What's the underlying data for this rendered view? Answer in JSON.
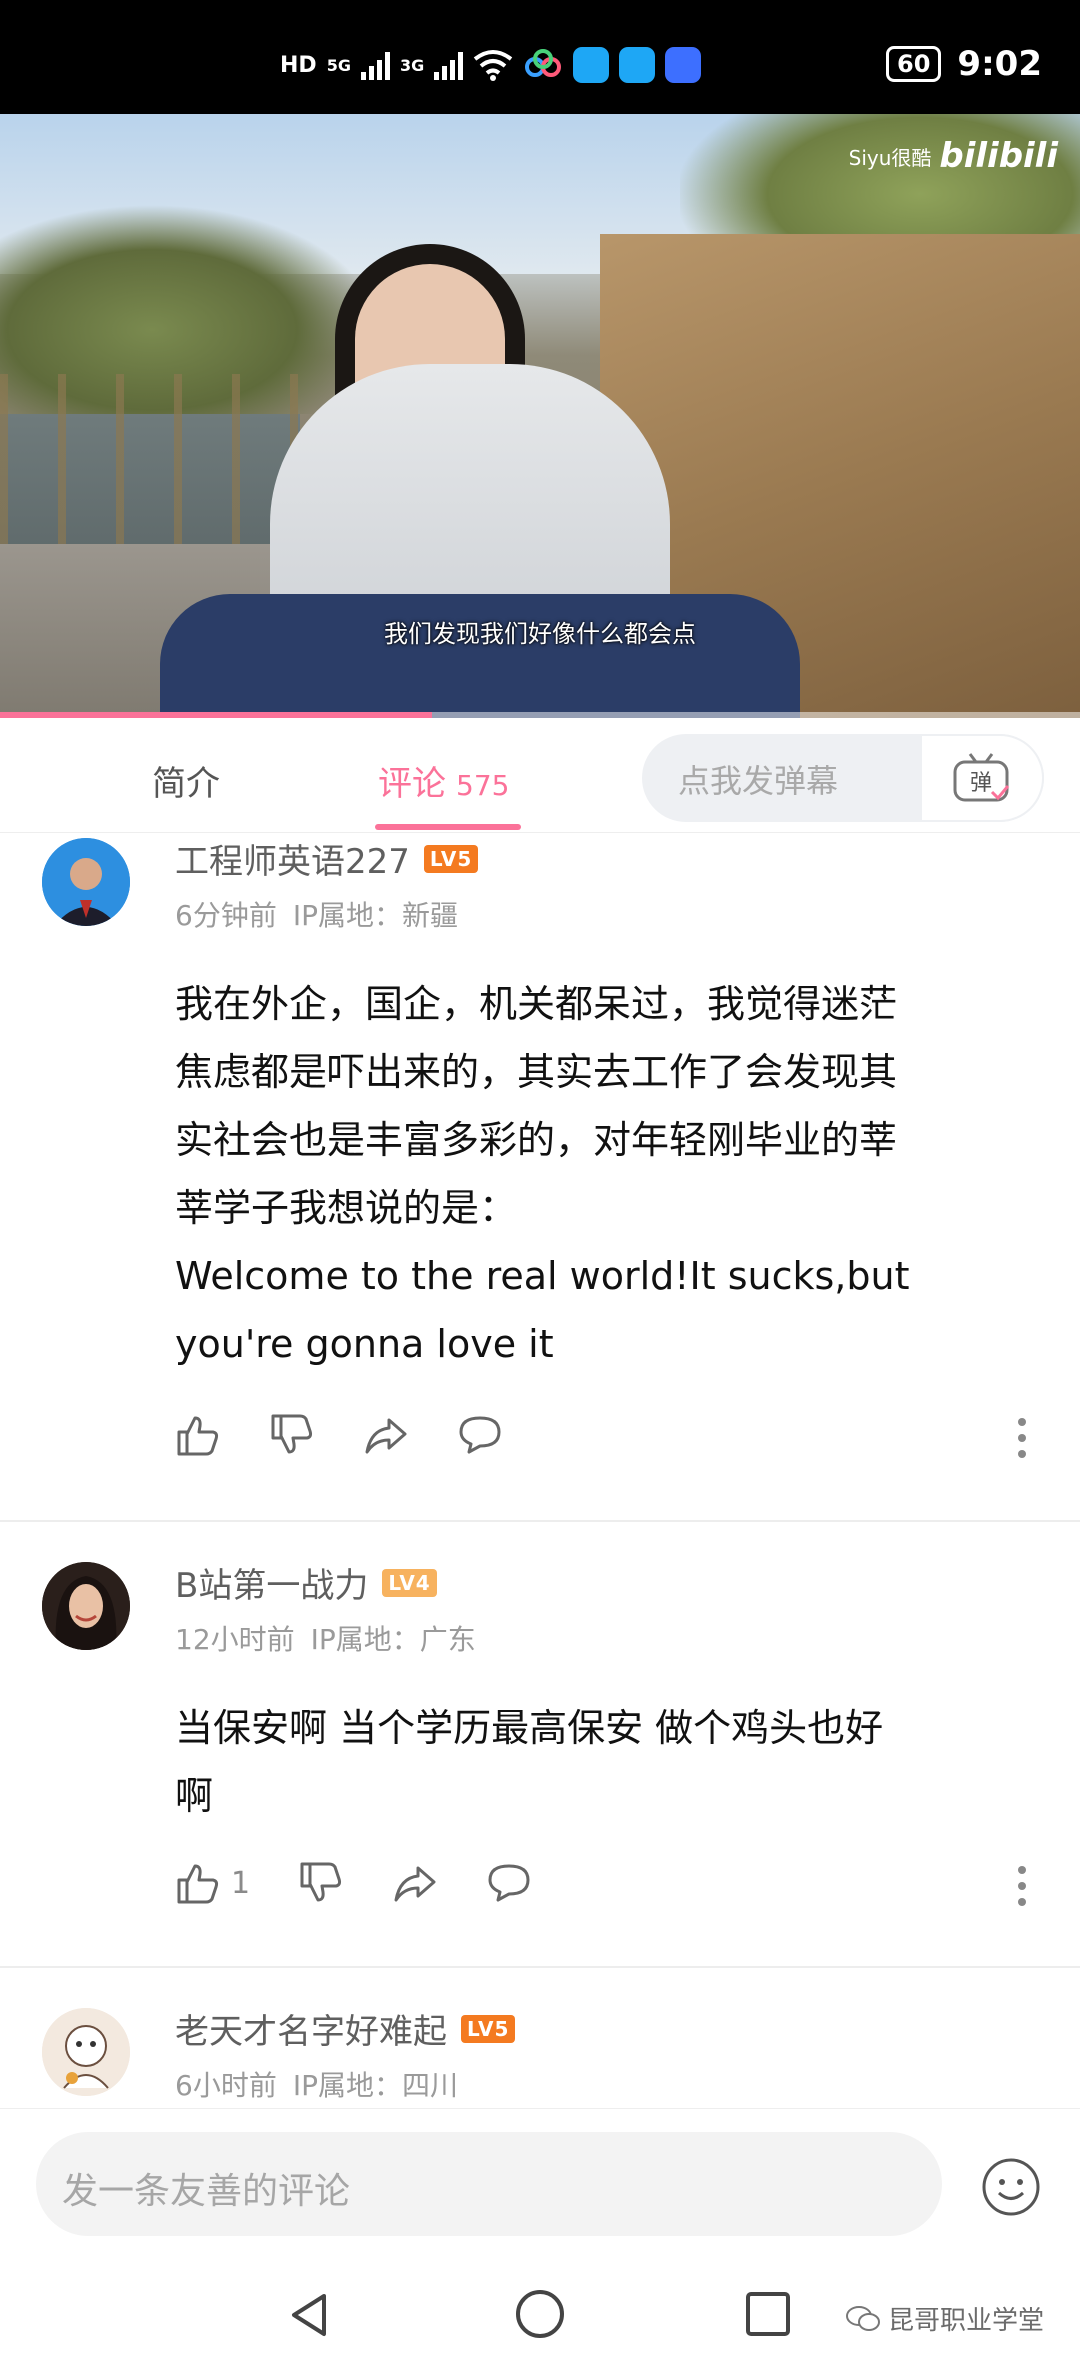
{
  "status_bar": {
    "network_labels": [
      "HD",
      "5G",
      "3G"
    ],
    "battery": "60",
    "time": "9:02"
  },
  "video": {
    "watermark_text": "Siyu很酷",
    "watermark_logo": "bilibili",
    "subtitle": "我们发现我们好像什么都会点",
    "progress_fraction": 0.4
  },
  "tabs": {
    "intro_label": "简介",
    "comments_label": "评论",
    "comments_count": "575",
    "danmaku_placeholder": "点我发弹幕",
    "danmaku_icon": "弹"
  },
  "comments": [
    {
      "username": "工程师英语227",
      "level": "LV5",
      "level_color": "#f47a20",
      "time": "6分钟前",
      "ip": "IP属地：新疆",
      "text_lines": [
        "我在外企，国企，机关都呆过，我觉得迷茫",
        "焦虑都是吓出来的，其实去工作了会发现其",
        "实社会也是丰富多彩的，对年轻刚毕业的莘",
        "莘学子我想说的是：",
        "Welcome to the real world!It sucks,but",
        "you're gonna love it"
      ],
      "likes": ""
    },
    {
      "username": "B站第一战力",
      "level": "LV4",
      "level_color": "#f7b25f",
      "time": "12小时前",
      "ip": "IP属地：广东",
      "text_lines": [
        "当保安啊 当个学历最高保安 做个鸡头也好",
        "啊"
      ],
      "likes": "1"
    },
    {
      "username": "老天才名字好难起",
      "level": "LV5",
      "level_color": "#f47a20",
      "time": "6小时前",
      "ip": "IP属地：四川"
    }
  ],
  "input": {
    "placeholder": "发一条友善的评论"
  },
  "watermark_footer": "昆哥职业学堂",
  "colors": {
    "accent_pink": "#fb7299",
    "text_dark": "#111111",
    "meta_gray": "#9a9a9a"
  }
}
